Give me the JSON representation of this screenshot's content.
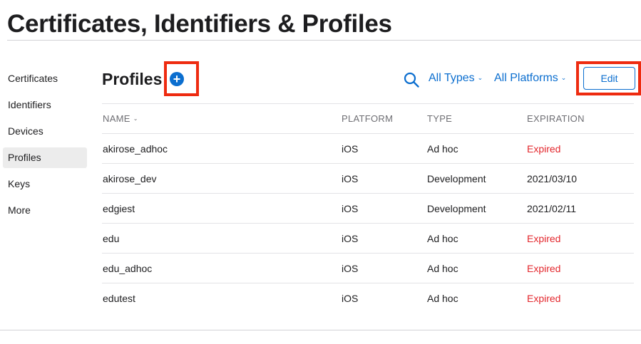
{
  "page": {
    "title": "Certificates, Identifiers & Profiles"
  },
  "sidebar": {
    "items": [
      {
        "label": "Certificates",
        "active": false
      },
      {
        "label": "Identifiers",
        "active": false
      },
      {
        "label": "Devices",
        "active": false
      },
      {
        "label": "Profiles",
        "active": true
      },
      {
        "label": "Keys",
        "active": false
      },
      {
        "label": "More",
        "active": false
      }
    ]
  },
  "section": {
    "title": "Profiles",
    "add_glyph": "+",
    "filters": {
      "types": "All Types",
      "platforms": "All Platforms"
    },
    "edit_label": "Edit"
  },
  "table": {
    "headers": {
      "name": "NAME",
      "platform": "PLATFORM",
      "type": "TYPE",
      "expiration": "EXPIRATION"
    },
    "rows": [
      {
        "name": "akirose_adhoc",
        "platform": "iOS",
        "type": "Ad hoc",
        "expiration": "Expired"
      },
      {
        "name": "akirose_dev",
        "platform": "iOS",
        "type": "Development",
        "expiration": "2021/03/10"
      },
      {
        "name": "edgiest",
        "platform": "iOS",
        "type": "Development",
        "expiration": "2021/02/11"
      },
      {
        "name": "edu",
        "platform": "iOS",
        "type": "Ad hoc",
        "expiration": "Expired"
      },
      {
        "name": "edu_adhoc",
        "platform": "iOS",
        "type": "Ad hoc",
        "expiration": "Expired"
      },
      {
        "name": "edutest",
        "platform": "iOS",
        "type": "Ad hoc",
        "expiration": "Expired"
      }
    ]
  },
  "colors": {
    "accent": "#0b6ecf",
    "expired": "#e3272d",
    "highlight": "#ee2b10"
  },
  "icons": {
    "search": "search-icon",
    "add": "plus-circle-icon",
    "sort": "chevron-down-icon"
  }
}
